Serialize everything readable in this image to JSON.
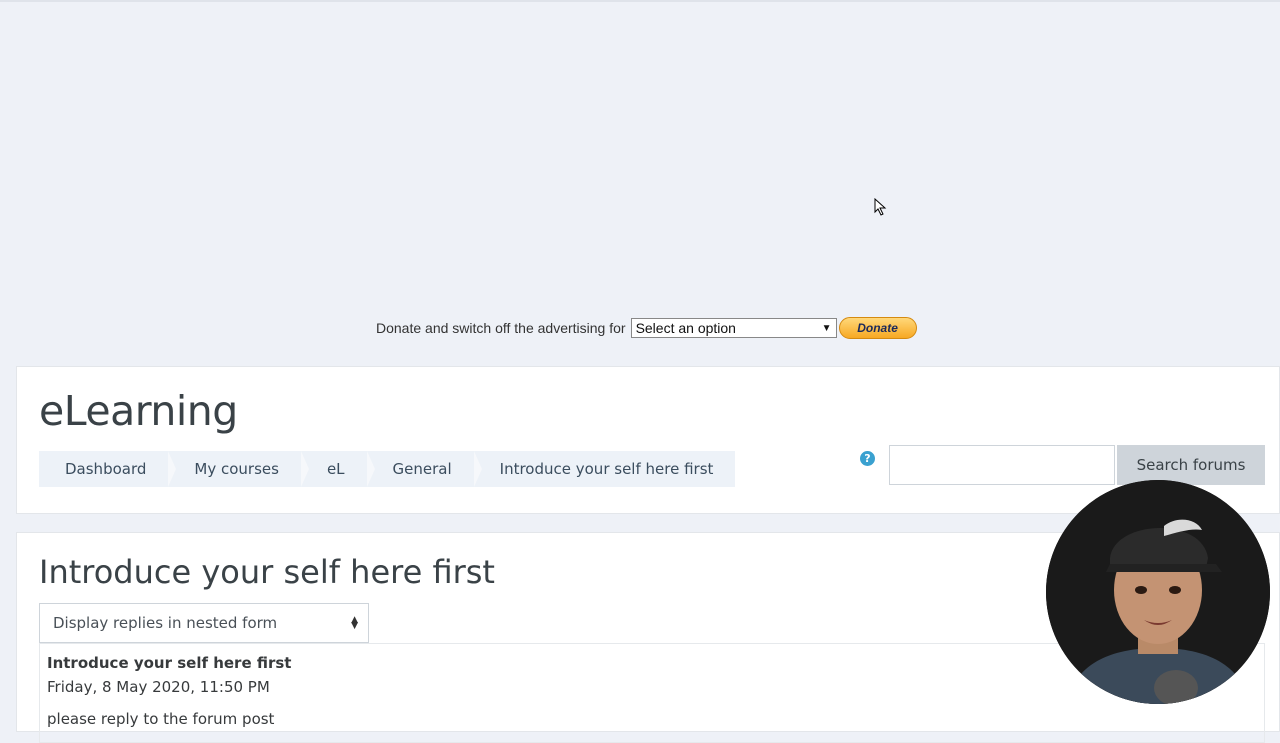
{
  "donate": {
    "text": "Donate and switch off the advertising for",
    "select_value": "Select an option",
    "button_label": "Donate"
  },
  "header": {
    "site_title": "eLearning",
    "breadcrumb": [
      "Dashboard",
      "My courses",
      "eL",
      "General",
      "Introduce your self here first"
    ],
    "help_icon": "?",
    "search_placeholder": "",
    "search_button": "Search forums"
  },
  "main": {
    "page_title": "Introduce your self here first",
    "display_mode": "Display replies in nested form",
    "post": {
      "subject": "Introduce your self here first",
      "date": "Friday, 8 May 2020, 11:50 PM",
      "body": "please reply to the forum post"
    }
  },
  "colors": {
    "page_bg": "#eef1f7",
    "breadcrumb_bg": "#edf2f8",
    "help_icon": "#3aa1d0",
    "donate_button": "#f7a823"
  }
}
